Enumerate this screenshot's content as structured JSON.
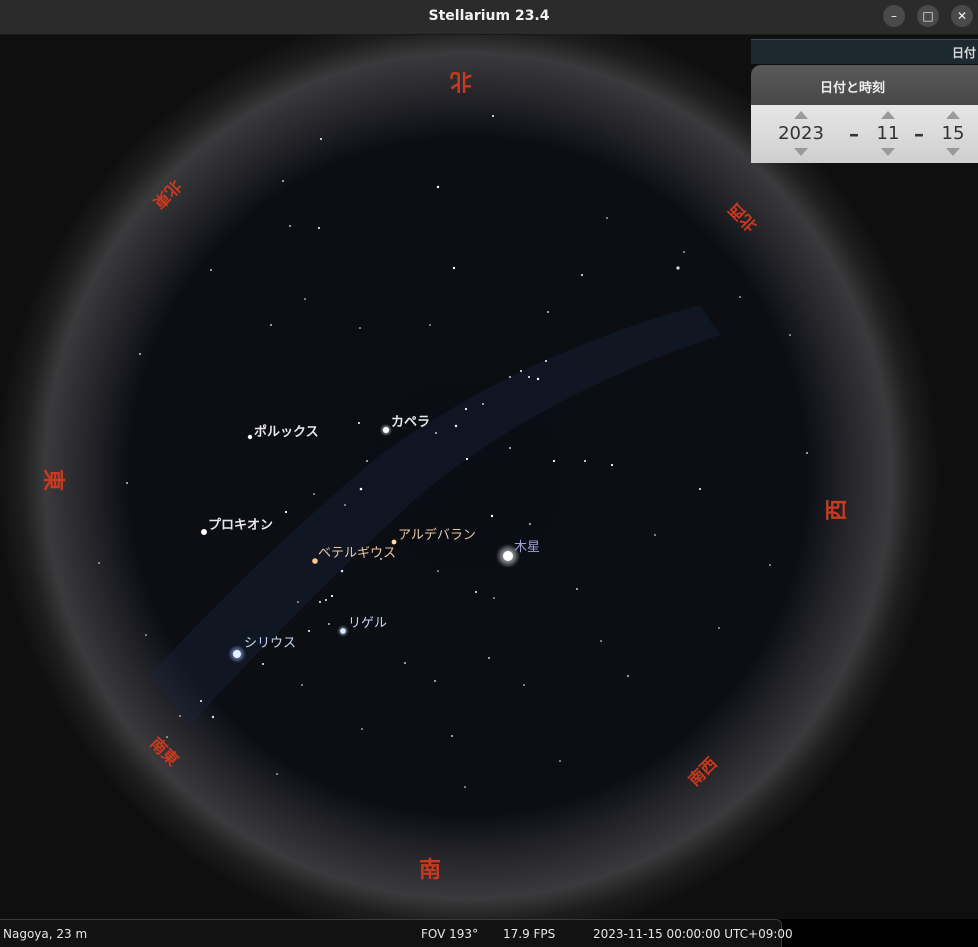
{
  "window": {
    "title": "Stellarium 23.4"
  },
  "window_controls": {
    "minimize": "–",
    "maximize": "□",
    "close": "✕"
  },
  "date_panel": {
    "strip_label": "日付",
    "title": "日付と時刻",
    "year": "2023",
    "month": "11",
    "day": "15",
    "separator": "–"
  },
  "compass": {
    "north": "北",
    "northwest": "北西",
    "west": "西",
    "southwest": "南西",
    "south": "南",
    "southeast": "南東",
    "east": "東",
    "northeast": "北東"
  },
  "objects": {
    "pollux": "ポルックス",
    "capella": "カペラ",
    "procyon": "プロキオン",
    "aldebaran": "アルデバラン",
    "betelgeuse": "ベテルギウス",
    "jupiter": "木星",
    "rigel": "リゲル",
    "sirius": "シリウス"
  },
  "status": {
    "location": "Nagoya, 23 m",
    "fov": "FOV 193°",
    "fps": "17.9 FPS",
    "datetime": "2023-11-15 00:00:00 UTC+09:00"
  },
  "colors": {
    "cardinal": "#c8391f",
    "star_label": "#e8e8e8",
    "planet_label": "#9ea0e0",
    "warm_label": "#e8c9a0"
  }
}
